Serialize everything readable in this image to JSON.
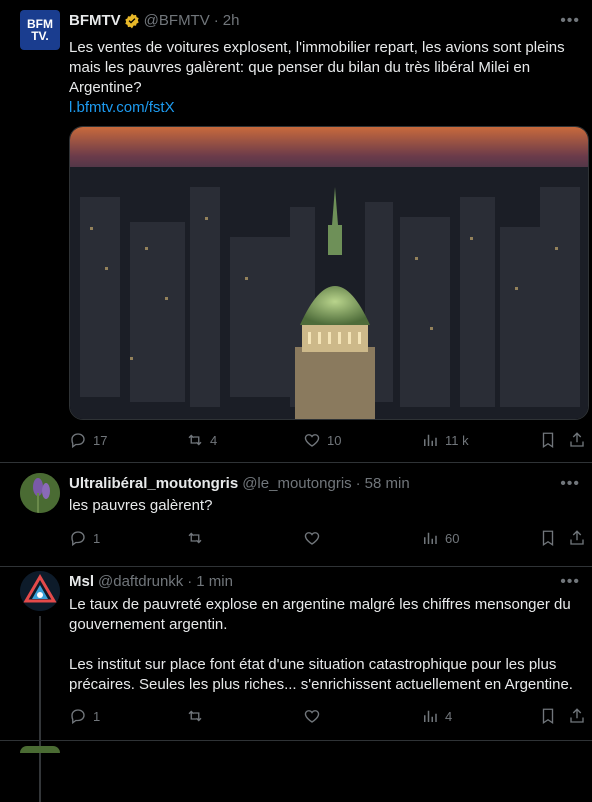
{
  "tweets": [
    {
      "author": "BFMTV",
      "handle": "@BFMTV",
      "time": "2h",
      "avatar_text": "BFM TV.",
      "text": "Les ventes de voitures explosent, l'immobilier repart, les avions sont pleins mais les pauvres galèrent: que penser du bilan du très libéral Milei en Argentine?",
      "link": "l.bfmtv.com/fstX",
      "stats": {
        "replies": "17",
        "reposts": "4",
        "likes": "10",
        "views": "11 k"
      }
    },
    {
      "author": "Ultralibéral_moutongris",
      "handle": "@le_moutongris",
      "time": "58 min",
      "text": "les pauvres galèrent?",
      "stats": {
        "replies": "1",
        "reposts": "",
        "likes": "",
        "views": "60"
      }
    },
    {
      "author": "Msl",
      "handle": "@daftdrunkk",
      "time": "1 min",
      "text": "Le taux de pauvreté explose en argentine malgré les chiffres mensonger du gouvernement argentin.\n\nLes institut sur place font état d'une situation catastrophique pour les plus précaires. Seules les plus riches... s'enrichissent actuellement en Argentine.",
      "stats": {
        "replies": "1",
        "reposts": "",
        "likes": "",
        "views": "4"
      }
    }
  ],
  "ui": {
    "dot": "·",
    "more": "•••"
  },
  "colors": {
    "accent": "#1d9bf0",
    "muted": "#71767b",
    "verified": "#e8b829",
    "background": "#000000"
  }
}
